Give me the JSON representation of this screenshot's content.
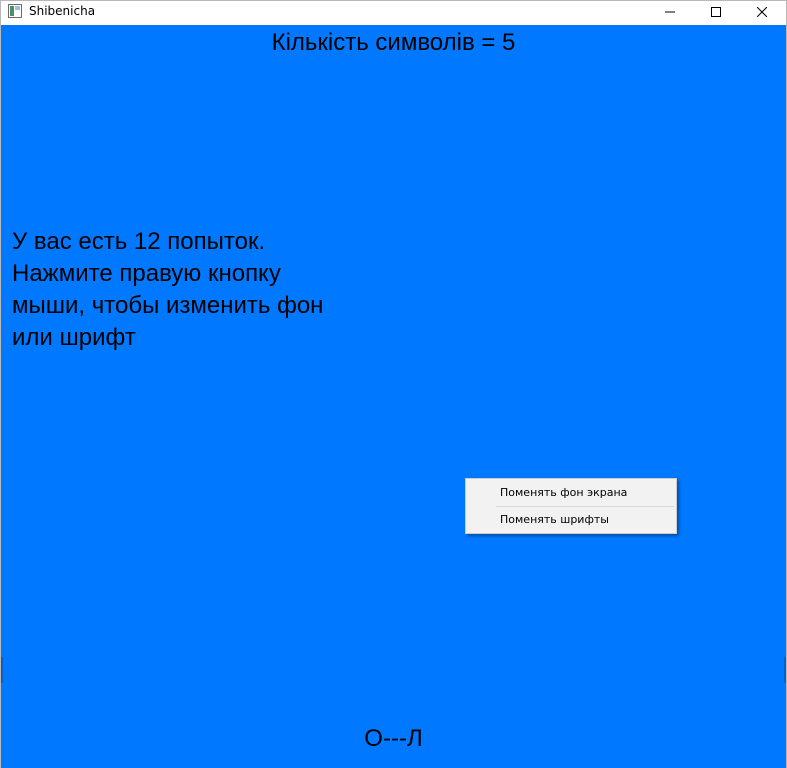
{
  "window": {
    "title": "Shibenicha",
    "app_icon": "window-app-icon",
    "controls": [
      "minimize-icon",
      "maximize-icon",
      "close-icon"
    ]
  },
  "game": {
    "background_color": "#0078ff",
    "heading": "Кількість символів = 5",
    "info_lines": [
      "У вас есть 12 попыток.",
      "Нажмите правую кнопку",
      "мыши, чтобы изменить фон",
      "или шрифт"
    ],
    "word_display": "О---Л"
  },
  "context_menu": {
    "items": [
      {
        "label": "Поменять фон экрана"
      },
      {
        "label": "Поменять шрифты"
      }
    ]
  }
}
